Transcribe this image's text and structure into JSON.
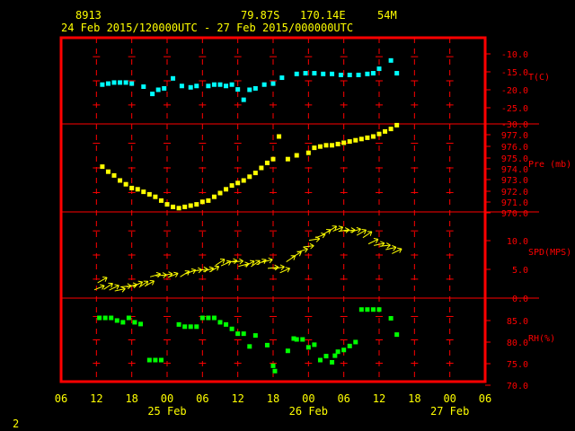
{
  "header": {
    "station": "8913",
    "lat": "79.87S",
    "lon": "170.14E",
    "elev": "54M",
    "period": "24 Feb 2015/120000UTC - 27 Feb 2015/000000UTC"
  },
  "footer": {
    "page_num": "2"
  },
  "colors": {
    "frame": "#ff0000",
    "text": "#ffff00",
    "temp": "#00ffff",
    "pressure": "#ffff00",
    "wind": "#ffff00",
    "rh": "#00ff00"
  },
  "chart_data": {
    "type": "scatter",
    "x_axis": {
      "unit": "hours since 24 Feb 2015 06 UTC",
      "range": [
        0,
        72
      ],
      "tick_labels": [
        "06",
        "12",
        "18",
        "00",
        "06",
        "12",
        "18",
        "00",
        "06",
        "12",
        "18",
        "00",
        "06"
      ],
      "date_labels": [
        {
          "label": "25 Feb",
          "x": 18
        },
        {
          "label": "26 Feb",
          "x": 42
        },
        {
          "label": "27 Feb",
          "x": 66
        }
      ]
    },
    "panels": [
      {
        "name": "temperature",
        "label": "T(C)",
        "range": [
          -30,
          -5
        ],
        "ticks": [
          "-10.0",
          "-15.0",
          "-20.0",
          "-25.0",
          "-30.0"
        ],
        "points": [
          [
            7,
            -18.6
          ],
          [
            8,
            -18.3
          ],
          [
            9,
            -18.0
          ],
          [
            10,
            -18.0
          ],
          [
            11,
            -18.0
          ],
          [
            12,
            -18.3
          ],
          [
            14,
            -19.2
          ],
          [
            15.5,
            -21.3
          ],
          [
            16.5,
            -20.1
          ],
          [
            17.5,
            -19.7
          ],
          [
            19,
            -16.8
          ],
          [
            20.5,
            -19.0
          ],
          [
            22,
            -19.4
          ],
          [
            23,
            -19.0
          ],
          [
            25,
            -19.0
          ],
          [
            26,
            -18.6
          ],
          [
            27,
            -18.6
          ],
          [
            28,
            -19.0
          ],
          [
            29,
            -18.6
          ],
          [
            30,
            -20.0
          ],
          [
            31,
            -23.0
          ],
          [
            32,
            -20.1
          ],
          [
            33,
            -19.7
          ],
          [
            34.5,
            -18.6
          ],
          [
            36,
            -18.3
          ],
          [
            37.5,
            -16.6
          ],
          [
            40,
            -15.5
          ],
          [
            41.5,
            -15.3
          ],
          [
            43,
            -15.3
          ],
          [
            44.5,
            -15.5
          ],
          [
            46,
            -15.5
          ],
          [
            47.5,
            -15.8
          ],
          [
            49,
            -15.8
          ],
          [
            50.5,
            -15.8
          ],
          [
            52,
            -15.5
          ],
          [
            53,
            -15.3
          ],
          [
            54,
            -14.0
          ],
          [
            56,
            -11.6
          ],
          [
            57,
            -15.3
          ]
        ]
      },
      {
        "name": "pressure",
        "label": "Pre (mb)",
        "range": [
          970,
          977
        ],
        "ticks": [
          "977.0",
          "976.0",
          "975.0",
          "974.0",
          "973.0",
          "972.0",
          "971.0",
          "970.0"
        ],
        "points": [
          [
            7,
            973.6
          ],
          [
            8,
            973.2
          ],
          [
            9,
            972.9
          ],
          [
            10,
            972.5
          ],
          [
            11,
            972.2
          ],
          [
            12,
            971.9
          ],
          [
            13,
            971.8
          ],
          [
            14,
            971.6
          ],
          [
            15,
            971.4
          ],
          [
            16,
            971.2
          ],
          [
            17,
            970.9
          ],
          [
            18,
            970.6
          ],
          [
            19,
            970.4
          ],
          [
            20,
            970.3
          ],
          [
            21,
            970.4
          ],
          [
            22,
            970.5
          ],
          [
            23,
            970.6
          ],
          [
            24,
            970.8
          ],
          [
            25,
            970.9
          ],
          [
            26,
            971.2
          ],
          [
            27,
            971.5
          ],
          [
            28,
            971.8
          ],
          [
            29,
            972.1
          ],
          [
            30,
            972.3
          ],
          [
            31,
            972.5
          ],
          [
            32,
            972.8
          ],
          [
            33,
            973.1
          ],
          [
            34,
            973.5
          ],
          [
            35,
            973.9
          ],
          [
            36,
            974.2
          ],
          [
            37,
            976.0
          ],
          [
            38.5,
            974.2
          ],
          [
            40,
            974.5
          ],
          [
            42,
            974.7
          ],
          [
            43,
            975.1
          ],
          [
            44,
            975.2
          ],
          [
            45,
            975.3
          ],
          [
            46,
            975.3
          ],
          [
            47,
            975.4
          ],
          [
            48,
            975.5
          ],
          [
            49,
            975.6
          ],
          [
            50,
            975.7
          ],
          [
            51,
            975.8
          ],
          [
            52,
            975.9
          ],
          [
            53,
            976.0
          ],
          [
            54,
            976.2
          ],
          [
            55,
            976.4
          ],
          [
            56,
            976.6
          ],
          [
            57,
            976.9
          ]
        ]
      },
      {
        "name": "wind",
        "label": "SPD(MPS)",
        "range": [
          0,
          12.5
        ],
        "ticks": [
          "10.0",
          "5.0",
          "0.0"
        ],
        "points": [
          [
            6.5,
            1.5
          ],
          [
            7,
            2.6
          ],
          [
            8,
            1.7
          ],
          [
            9,
            1.5
          ],
          [
            10,
            1.2
          ],
          [
            11,
            1.7
          ],
          [
            12,
            1.8
          ],
          [
            13,
            2.0
          ],
          [
            14,
            2.0
          ],
          [
            15,
            2.1
          ],
          [
            16,
            3.3
          ],
          [
            17,
            3.3
          ],
          [
            18,
            3.4
          ],
          [
            19,
            3.3
          ],
          [
            21,
            3.5
          ],
          [
            22,
            3.8
          ],
          [
            23,
            4.0
          ],
          [
            24,
            4.1
          ],
          [
            25,
            4.1
          ],
          [
            26,
            4.2
          ],
          [
            27,
            5.2
          ],
          [
            28,
            5.0
          ],
          [
            29,
            5.3
          ],
          [
            30,
            5.3
          ],
          [
            31,
            4.8
          ],
          [
            32,
            5.0
          ],
          [
            33,
            5.0
          ],
          [
            34,
            5.2
          ],
          [
            35,
            5.4
          ],
          [
            36,
            4.4
          ],
          [
            37,
            4.4
          ],
          [
            38,
            4.0
          ],
          [
            39,
            5.7
          ],
          [
            40,
            6.3
          ],
          [
            41,
            6.9
          ],
          [
            42,
            7.5
          ],
          [
            43,
            8.5
          ],
          [
            44,
            9.0
          ],
          [
            45,
            9.5
          ],
          [
            46,
            10.0
          ],
          [
            47,
            10.0
          ],
          [
            48,
            9.8
          ],
          [
            49,
            9.8
          ],
          [
            50,
            9.8
          ],
          [
            51,
            9.5
          ],
          [
            52,
            9.2
          ],
          [
            53,
            8.2
          ],
          [
            54,
            7.8
          ],
          [
            55,
            7.6
          ],
          [
            56,
            7.2
          ],
          [
            57,
            6.8
          ]
        ]
      },
      {
        "name": "rh",
        "label": "RH(%)",
        "range": [
          70,
          89
        ],
        "ticks": [
          "85.0",
          "80.0",
          "75.0",
          "70.0"
        ],
        "points": [
          [
            6.5,
            84.5
          ],
          [
            7.5,
            84.5
          ],
          [
            8.5,
            84.5
          ],
          [
            9.5,
            83.9
          ],
          [
            10.5,
            83.5
          ],
          [
            11.5,
            84.5
          ],
          [
            12.5,
            83.5
          ],
          [
            13.5,
            83.1
          ],
          [
            15,
            74.9
          ],
          [
            16,
            74.9
          ],
          [
            17,
            74.9
          ],
          [
            20,
            83.0
          ],
          [
            21,
            82.5
          ],
          [
            22,
            82.5
          ],
          [
            23,
            82.5
          ],
          [
            24,
            84.5
          ],
          [
            25,
            84.5
          ],
          [
            26,
            84.5
          ],
          [
            27,
            83.5
          ],
          [
            28,
            83.0
          ],
          [
            29,
            82.0
          ],
          [
            30,
            80.9
          ],
          [
            31,
            80.9
          ],
          [
            32,
            78.0
          ],
          [
            33,
            80.5
          ],
          [
            35,
            78.3
          ],
          [
            36,
            73.6
          ],
          [
            36.3,
            72.4
          ],
          [
            38.5,
            77.0
          ],
          [
            39.5,
            79.8
          ],
          [
            40,
            79.6
          ],
          [
            41,
            79.6
          ],
          [
            42,
            77.8
          ],
          [
            43,
            78.4
          ],
          [
            44,
            74.9
          ],
          [
            45,
            75.8
          ],
          [
            46,
            74.4
          ],
          [
            46.5,
            75.9
          ],
          [
            47,
            76.8
          ],
          [
            48,
            77.2
          ],
          [
            49,
            78.1
          ],
          [
            50,
            79.0
          ],
          [
            51,
            86.4
          ],
          [
            52,
            86.4
          ],
          [
            53,
            86.4
          ],
          [
            54,
            86.4
          ],
          [
            56,
            84.4
          ],
          [
            57,
            80.7
          ]
        ]
      }
    ]
  }
}
